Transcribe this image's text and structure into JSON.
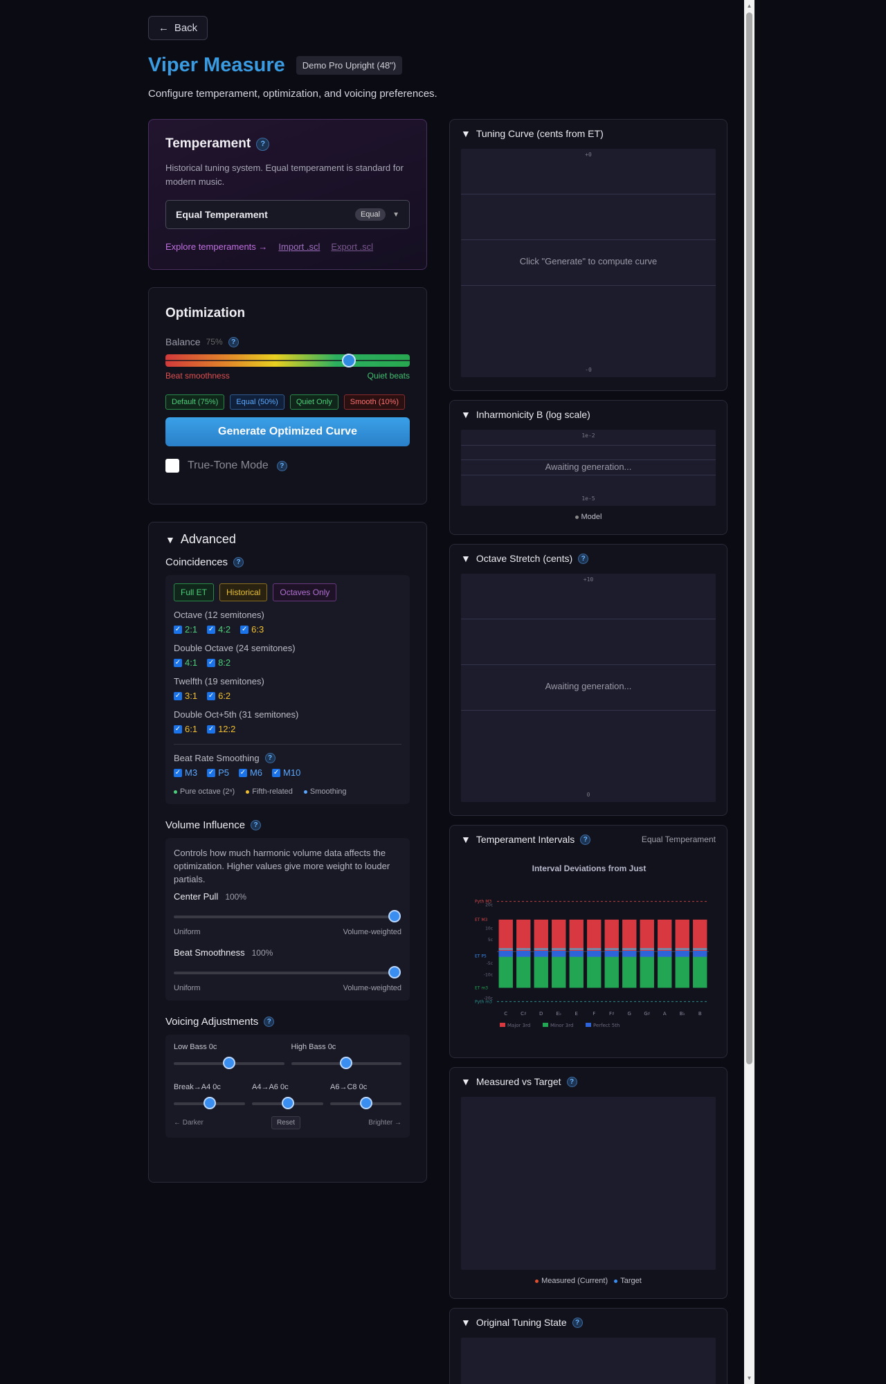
{
  "back_label": "Back",
  "app_title": "Viper Measure",
  "device_badge": "Demo Pro Upright (48\")",
  "subtitle": "Configure temperament, optimization, and voicing preferences.",
  "temperament": {
    "title": "Temperament",
    "description": "Historical tuning system. Equal temperament is standard for modern music.",
    "selected": "Equal Temperament",
    "selected_badge": "Equal",
    "links": {
      "explore": "Explore temperaments →",
      "import": "Import .scl",
      "export": "Export .scl"
    }
  },
  "optimization": {
    "title": "Optimization",
    "balance_label": "Balance",
    "balance_value": "75%",
    "balance_level": 0.75,
    "left_label": "Beat smoothness",
    "right_label": "Quiet beats",
    "presets": [
      "Default (75%)",
      "Equal (50%)",
      "Quiet Only",
      "Smooth (10%)"
    ],
    "generate_label": "Generate Optimized Curve",
    "true_tone_label": "True-Tone Mode",
    "true_tone_checked": false
  },
  "advanced": {
    "title": "Advanced",
    "coincidences": {
      "title": "Coincidences",
      "chips": [
        "Full ET",
        "Historical",
        "Octaves Only"
      ],
      "groups": [
        {
          "title": "Octave (12 semitones)",
          "items": [
            {
              "label": "2:1",
              "color": "green",
              "checked": true
            },
            {
              "label": "4:2",
              "color": "green",
              "checked": true
            },
            {
              "label": "6:3",
              "color": "yellow",
              "checked": true
            }
          ]
        },
        {
          "title": "Double Octave (24 semitones)",
          "items": [
            {
              "label": "4:1",
              "color": "green",
              "checked": true
            },
            {
              "label": "8:2",
              "color": "green",
              "checked": true
            }
          ]
        },
        {
          "title": "Twelfth (19 semitones)",
          "items": [
            {
              "label": "3:1",
              "color": "yellow",
              "checked": true
            },
            {
              "label": "6:2",
              "color": "yellow",
              "checked": true
            }
          ]
        },
        {
          "title": "Double Oct+5th (31 semitones)",
          "items": [
            {
              "label": "6:1",
              "color": "yellow",
              "checked": true
            },
            {
              "label": "12:2",
              "color": "yellow",
              "checked": true
            }
          ]
        }
      ],
      "beat_title": "Beat Rate Smoothing",
      "beat_items": [
        "M3",
        "P5",
        "M6",
        "M10"
      ],
      "legend": [
        "Pure octave (2ⁿ)",
        "Fifth-related",
        "Smoothing"
      ],
      "legend_colors": [
        "#4cd07a",
        "#f0c030",
        "#5aa8ff"
      ]
    },
    "volume": {
      "title": "Volume Influence",
      "description": "Controls how much harmonic volume data affects the optimization. Higher values give more weight to louder partials.",
      "sliders": [
        {
          "label": "Center Pull",
          "value": "100%",
          "level": 1.0,
          "left": "Uniform",
          "right": "Volume-weighted"
        },
        {
          "label": "Beat Smoothness",
          "value": "100%",
          "level": 1.0,
          "left": "Uniform",
          "right": "Volume-weighted"
        }
      ]
    },
    "voicing": {
      "title": "Voicing Adjustments",
      "low_bass": "Low Bass 0c",
      "high_bass": "High Bass 0c",
      "break_a4": "Break→A4 0c",
      "a4_a6": "A4→A6 0c",
      "a6_c8": "A6→C8 0c",
      "darker": "← Darker",
      "reset": "Reset",
      "brighter": "Brighter →"
    }
  },
  "panels": {
    "tuning_curve": {
      "title": "Tuning Curve (cents from ET)",
      "message": "Click \"Generate\" to compute curve",
      "top_tick": "+0",
      "bottom_tick": "-0"
    },
    "inharmonicity": {
      "title": "Inharmonicity B (log scale)",
      "message": "Awaiting generation...",
      "top_tick": "1e-2",
      "bottom_tick": "1e-5",
      "legend": "Model"
    },
    "octave_stretch": {
      "title": "Octave Stretch (cents)",
      "message": "Awaiting generation...",
      "top_tick": "+10",
      "bottom_tick": "0"
    },
    "intervals": {
      "title": "Temperament Intervals",
      "subtitle": "Equal Temperament"
    },
    "measured": {
      "title": "Measured vs Target",
      "legend_measured": "Measured (Current)",
      "legend_target": "Target",
      "measured_color": "#e05030",
      "target_color": "#3a8ef0"
    },
    "original": {
      "title": "Original Tuning State"
    }
  },
  "chart_data": {
    "type": "bar",
    "title": "Interval Deviations from Just",
    "categories": [
      "C",
      "C♯",
      "D",
      "E♭",
      "E",
      "F",
      "F♯",
      "G",
      "G♯",
      "A",
      "B♭",
      "B"
    ],
    "series": [
      {
        "name": "Major 3rd",
        "color": "#d8383f",
        "values": [
          13.7,
          13.7,
          13.7,
          13.7,
          13.7,
          13.7,
          13.7,
          13.7,
          13.7,
          13.7,
          13.7,
          13.7
        ]
      },
      {
        "name": "Minor 3rd",
        "color": "#22a653",
        "values": [
          -15.6,
          -15.6,
          -15.6,
          -15.6,
          -15.6,
          -15.6,
          -15.6,
          -15.6,
          -15.6,
          -15.6,
          -15.6,
          -15.6
        ]
      },
      {
        "name": "Perfect 5th",
        "color": "#2f64d8",
        "values": [
          -2.0,
          -2.0,
          -2.0,
          -2.0,
          -2.0,
          -2.0,
          -2.0,
          -2.0,
          -2.0,
          -2.0,
          -2.0,
          -2.0
        ]
      }
    ],
    "ylim": [
      -22,
      22
    ],
    "y_ticks": [
      "20c",
      "10c",
      "5c",
      "-5c",
      "-10c",
      "-20c"
    ],
    "reference_labels": [
      "Pyth M3",
      "ET M3",
      "ET P5",
      "ET m3",
      "Pyth m3"
    ],
    "grid": false,
    "legend_position": "bottom"
  }
}
